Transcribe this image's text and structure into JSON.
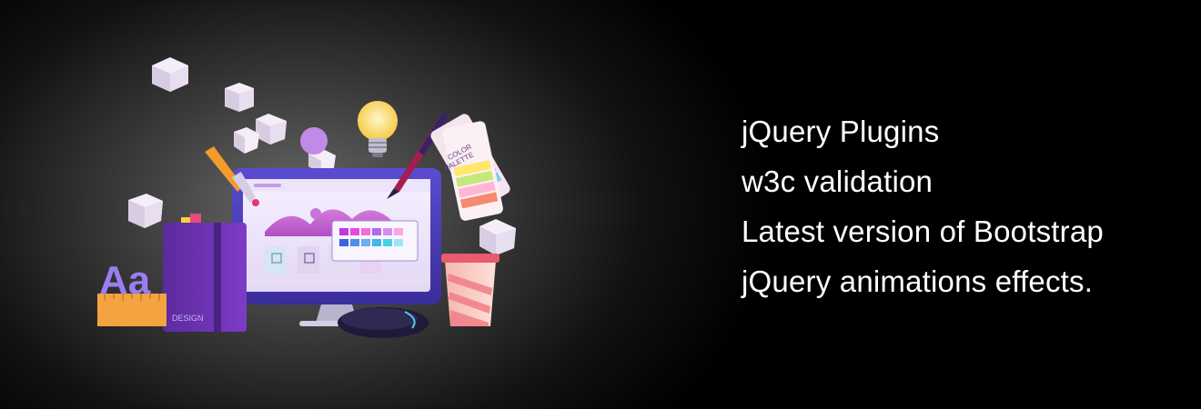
{
  "features": [
    "jQuery Plugins",
    "w3c validation",
    "Latest version of Bootstrap",
    "jQuery animations effects."
  ],
  "illustration": {
    "palette_label_line1": "COLOR",
    "palette_label_line2": "PALETTE",
    "book_label": "DESIGN",
    "letters_label": "Aa"
  },
  "colors": {
    "accent_purple": "#8a3fd1",
    "accent_pink": "#e86aa6",
    "text": "#ffffff"
  }
}
